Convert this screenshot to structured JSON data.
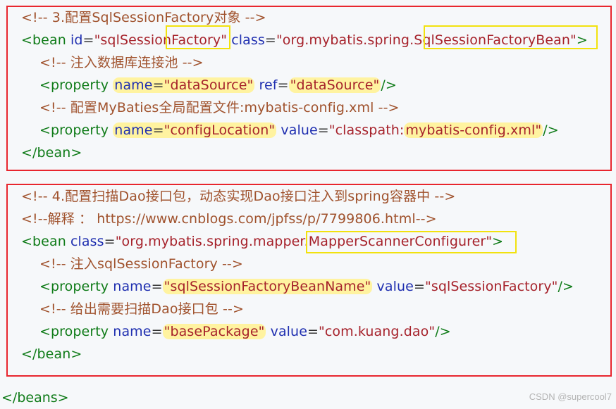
{
  "block1": {
    "line1": {
      "comment": "<!-- 3.配置SqlSessionFactory对象 -->"
    },
    "line2": {
      "open": "<bean",
      "id_attr": "id",
      "eq": "=",
      "id_val_a": "\"sqlSession",
      "id_val_b": "Factory\"",
      "class_attr": "class",
      "class_val_a": "\"org.mybatis.spring.",
      "class_val_b": "SqlSessionFactoryBean\"",
      "close": ">"
    },
    "line3": {
      "comment": "<!-- 注入数据库连接池 -->"
    },
    "line4": {
      "open": "<property",
      "name_attr": "name",
      "eq": "=",
      "name_val": "\"dataSource\"",
      "ref_attr": "ref",
      "ref_val": "\"dataSource\"",
      "close": "/>"
    },
    "line5": {
      "comment": "<!-- 配置MyBaties全局配置文件:mybatis-config.xml -->"
    },
    "line6": {
      "open": "<property",
      "name_attr": "name",
      "eq": "=",
      "name_val": "\"configLocation\"",
      "value_attr": "value",
      "value_val_a": "\"classpath:",
      "value_val_b": "mybatis-config.xml\"",
      "close": "/>"
    },
    "line7": {
      "close_tag": "</bean>"
    }
  },
  "block2": {
    "line1": {
      "comment": "<!-- 4.配置扫描Dao接口包，动态实现Dao接口注入到spring容器中 -->"
    },
    "line2": {
      "comment": "<!--解释 ： https://www.cnblogs.com/jpfss/p/7799806.html-->"
    },
    "line3": {
      "open": "<bean",
      "class_attr": "class",
      "eq": "=",
      "class_val_a": "\"org.mybatis.spring.mapper",
      "class_val_b": ".MapperScannerConfigurer\"",
      "close": ">"
    },
    "line4": {
      "comment": "<!-- 注入sqlSessionFactory -->"
    },
    "line5": {
      "open": "<property",
      "name_attr": "name",
      "eq": "=",
      "name_val": "\"sqlSessionFactoryBeanName\"",
      "value_attr": "value",
      "value_val": "\"sqlSessionFactory\"",
      "close": "/>"
    },
    "line6": {
      "comment": "<!-- 给出需要扫描Dao接口包 -->"
    },
    "line7": {
      "open": "<property",
      "name_attr": "name",
      "eq": "=",
      "name_val": "\"basePackage\"",
      "value_attr": "value",
      "value_val": "\"com.kuang.dao\"",
      "close": "/>"
    },
    "line8": {
      "close_tag": "</bean>"
    }
  },
  "closing_tag": "</beans>",
  "watermark": "CSDN @supercool7",
  "colors": {
    "border": "#e8262e",
    "highlight_box": "#f2e20e",
    "highlight_fill": "#fff3a0",
    "tag": "#0f7b18",
    "attr": "#1f2fb0",
    "string": "#a6222b",
    "comment": "#a0522d"
  }
}
